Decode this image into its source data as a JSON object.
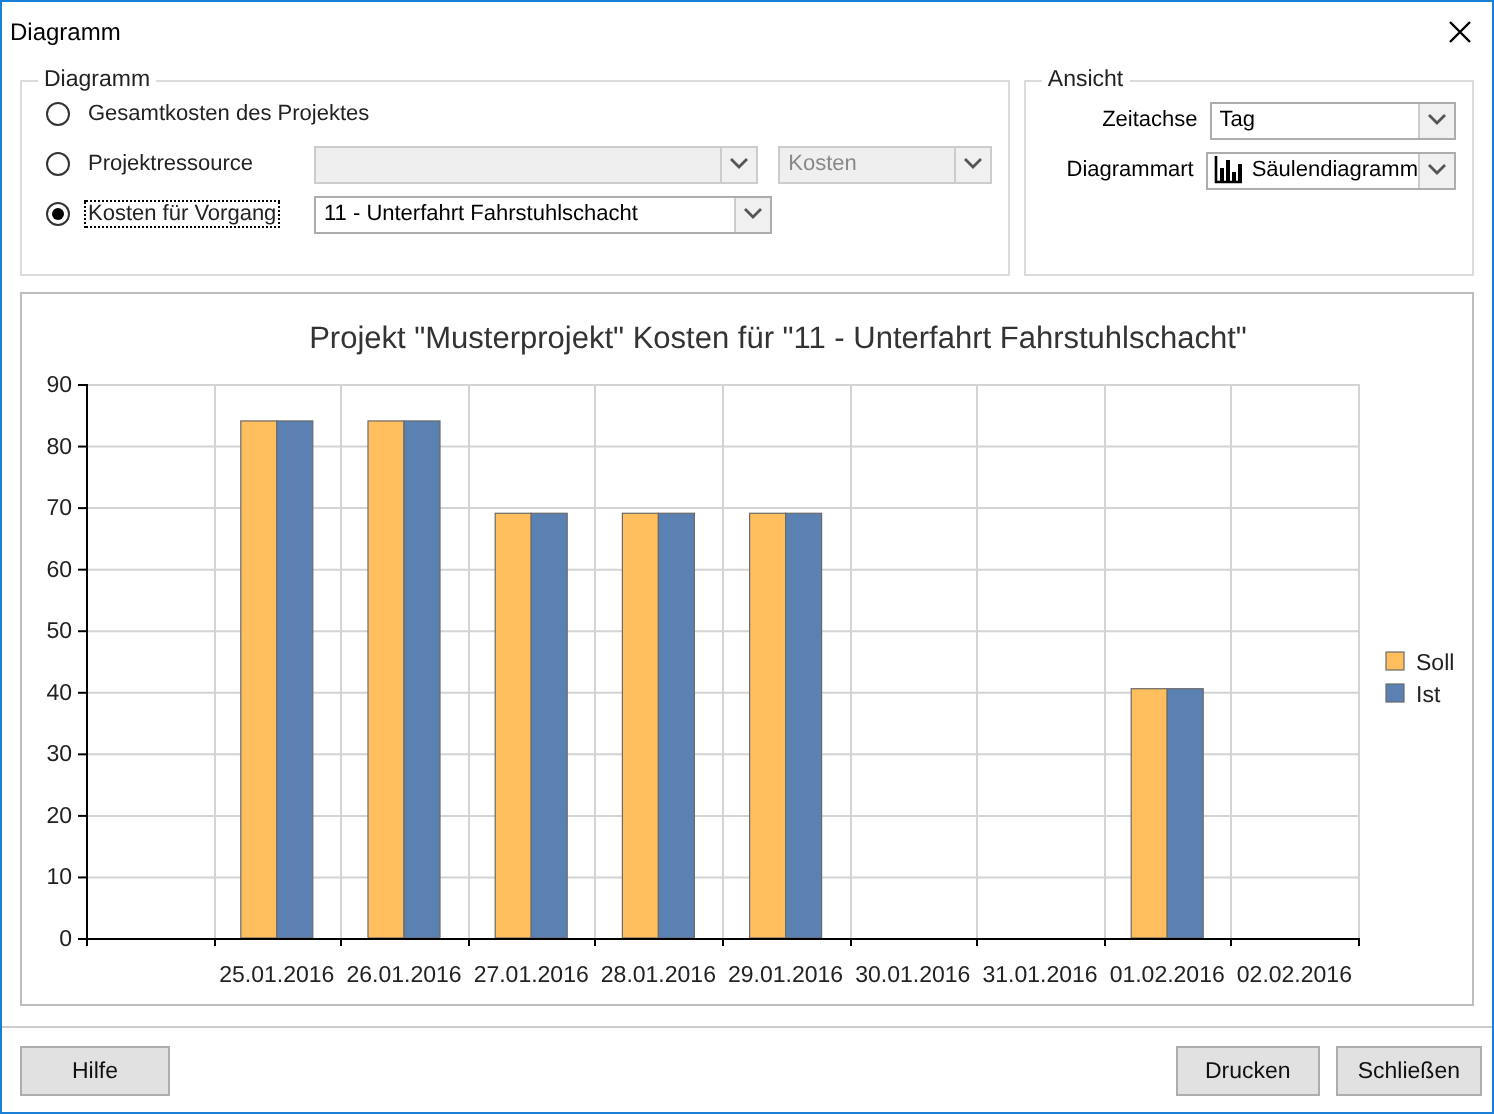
{
  "window": {
    "title": "Diagramm"
  },
  "diagram_group": {
    "title": "Diagramm",
    "options": [
      {
        "label": "Gesamtkosten des Projektes",
        "selected": false,
        "focused": false
      },
      {
        "label": "Projektressource",
        "selected": false,
        "focused": false,
        "combos": [
          {
            "disabled": true
          },
          {
            "value": "Kosten",
            "disabled": true
          }
        ]
      },
      {
        "label": "Kosten für Vorgang",
        "selected": true,
        "focused": true,
        "combos": [
          {
            "value": "11 - Unterfahrt Fahrstuhlschacht",
            "disabled": false
          }
        ]
      }
    ]
  },
  "view_group": {
    "title": "Ansicht",
    "fields": [
      {
        "label": "Zeitachse",
        "value": "Tag",
        "icon": false
      },
      {
        "label": "Diagrammart",
        "value": "Säulendiagramm",
        "icon": true
      }
    ]
  },
  "chart_data": {
    "type": "bar",
    "title": "Projekt \"Musterprojekt\" Kosten für \"11 - Unterfahrt Fahrstuhlschacht\"",
    "categories": [
      "25.01.2016",
      "26.01.2016",
      "27.01.2016",
      "28.01.2016",
      "29.01.2016",
      "30.01.2016",
      "31.01.2016",
      "01.02.2016",
      "02.02.2016"
    ],
    "series": [
      {
        "name": "Soll",
        "color": "#ffbf5f",
        "values": [
          84,
          84,
          69,
          69,
          69,
          0,
          0,
          40.5,
          0
        ]
      },
      {
        "name": "Ist",
        "color": "#5b80b2",
        "values": [
          84,
          84,
          69,
          69,
          69,
          0,
          0,
          40.5,
          0
        ]
      }
    ],
    "grid": true,
    "legend": true,
    "ylim": [
      0,
      90
    ],
    "yticks": [
      0,
      10,
      20,
      30,
      40,
      50,
      60,
      70,
      80,
      90
    ]
  },
  "buttons": {
    "left": [
      "Hilfe"
    ],
    "right": [
      "Drucken",
      "Schließen"
    ]
  }
}
